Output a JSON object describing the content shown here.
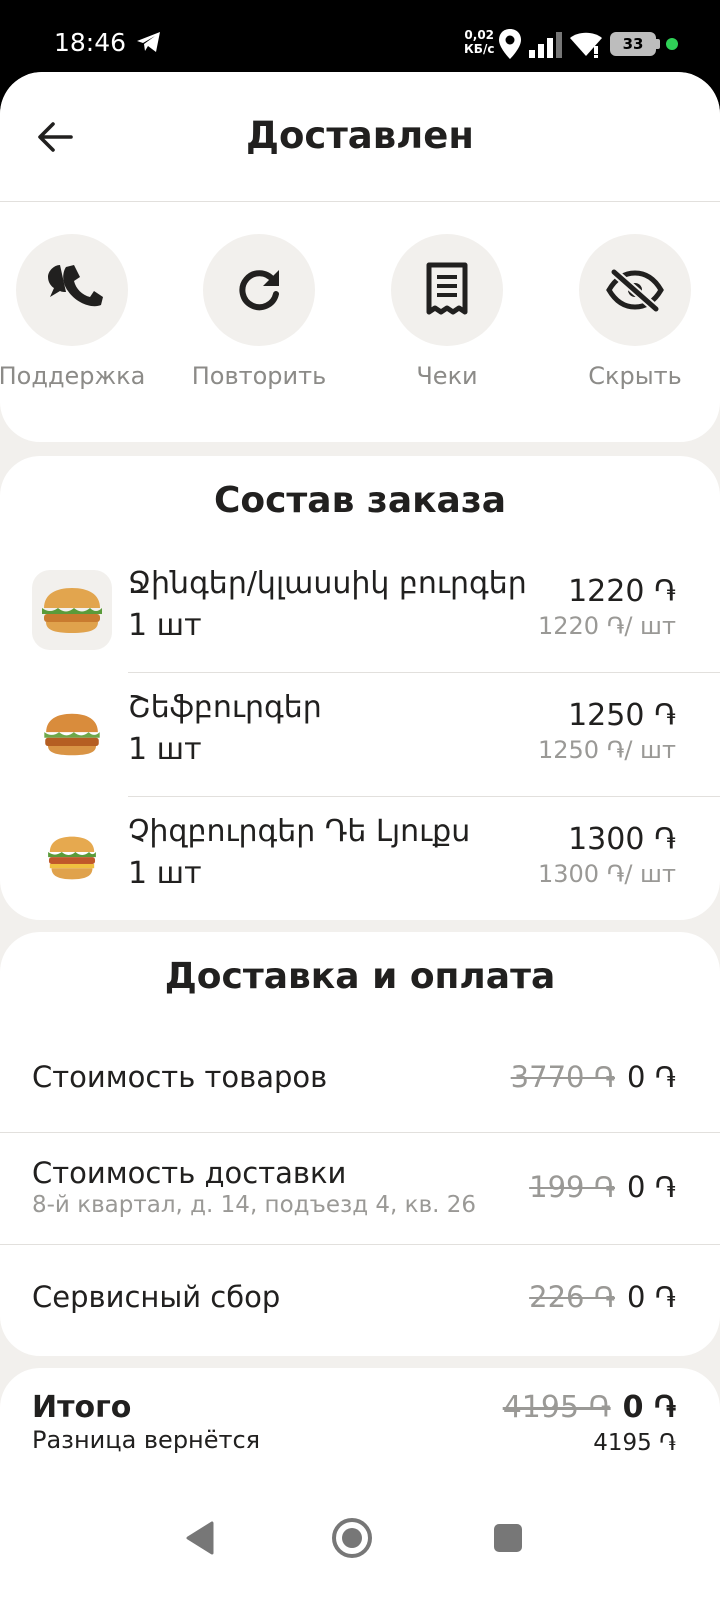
{
  "status_bar": {
    "time": "18:46",
    "net_speed_value": "0,02",
    "net_speed_unit": "КБ/с",
    "battery": "33"
  },
  "header": {
    "title": "Доставлен",
    "back_icon": "arrow-left-icon"
  },
  "actions": [
    {
      "label": "Поддержка",
      "icon": "phone-chat-icon"
    },
    {
      "label": "Повторить",
      "icon": "refresh-icon"
    },
    {
      "label": "Чеки",
      "icon": "receipt-icon"
    },
    {
      "label": "Скрыть",
      "icon": "eye-off-icon"
    }
  ],
  "order": {
    "title": "Состав заказа",
    "items": [
      {
        "name": "Ջինգեր/կլասսիկ բուրգեր",
        "qty": "1 шт",
        "price": "1220 ֏",
        "unit_price": "1220 ֏/ шт"
      },
      {
        "name": "Շեֆբուրգեր",
        "qty": "1 шт",
        "price": "1250 ֏",
        "unit_price": "1250 ֏/ шт"
      },
      {
        "name": "Չիզբուրգեր Դե Լյուքս",
        "qty": "1 шт",
        "price": "1300 ֏",
        "unit_price": "1300 ֏/ шт"
      }
    ]
  },
  "payment": {
    "title": "Доставка и оплата",
    "rows": [
      {
        "label": "Стоимость товаров",
        "sub": "",
        "old": "3770 ֏",
        "value": "0 ֏"
      },
      {
        "label": "Стоимость доставки",
        "sub": "8-й квартал, д. 14, подъезд 4, кв. 26",
        "old": "199 ֏",
        "value": "0 ֏"
      },
      {
        "label": "Сервисный сбор",
        "sub": "",
        "old": "226 ֏",
        "value": "0 ֏"
      }
    ]
  },
  "total": {
    "label": "Итого",
    "sub": "Разница вернётся",
    "old": "4195 ֏",
    "value": "0 ֏",
    "refund": "4195 ֏"
  },
  "colors": {
    "background": "#f2f0ed",
    "card": "#ffffff",
    "text": "#21201f",
    "muted": "#9a9996"
  }
}
